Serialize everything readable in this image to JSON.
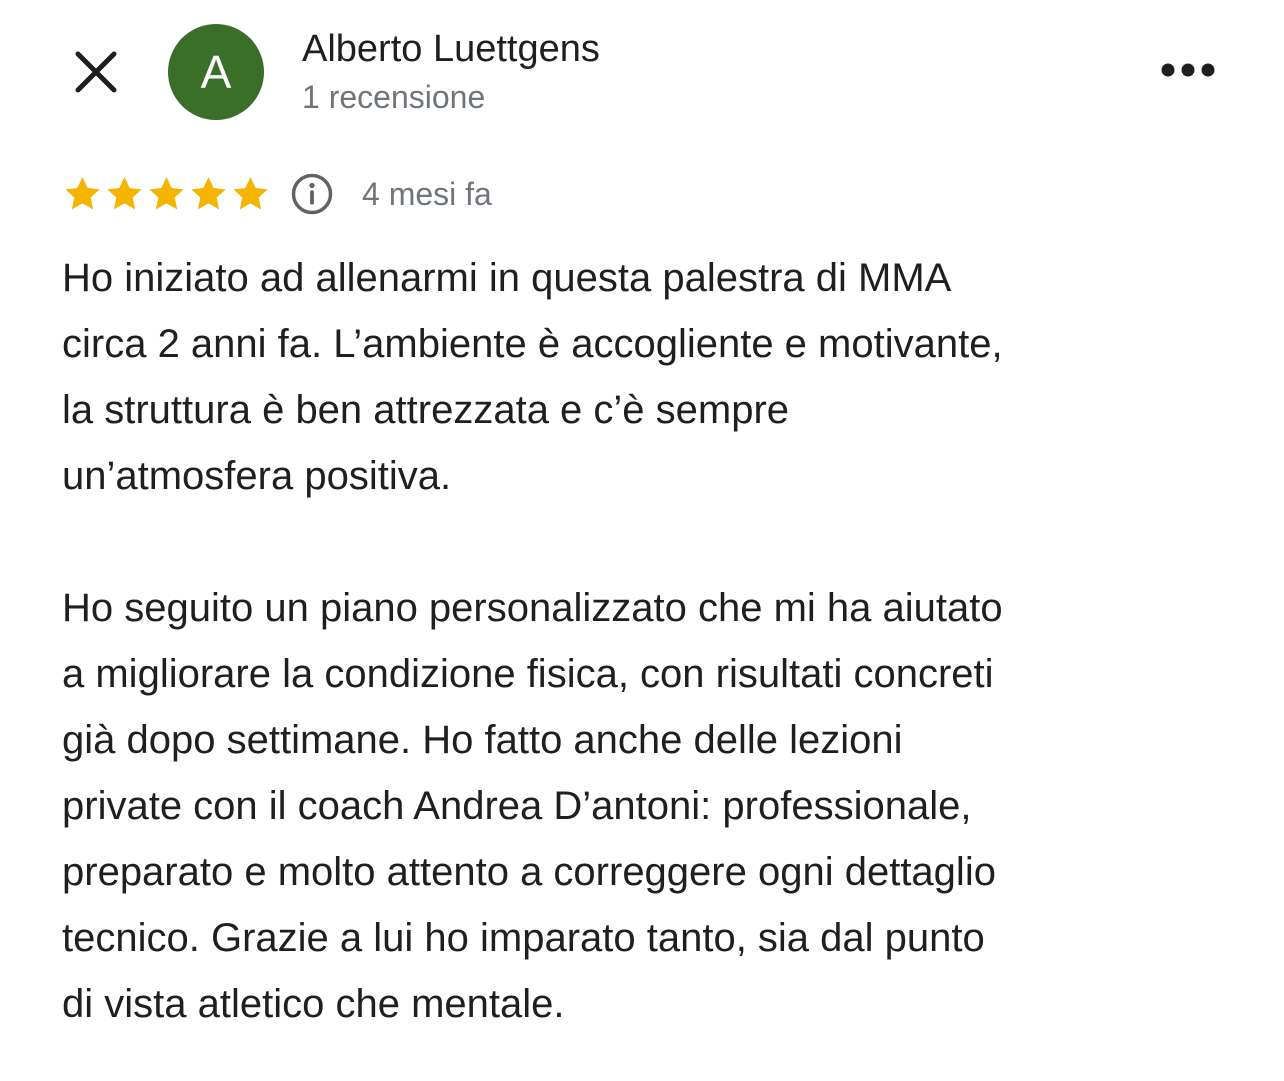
{
  "header": {
    "close_icon": "close-icon",
    "more_icon": "more-horizontal-icon",
    "avatar_letter": "A",
    "avatar_color": "#3a6f2a",
    "author_name": "Alberto Luettgens",
    "review_count": "1 recensione"
  },
  "review": {
    "rating": 5,
    "rating_max": 5,
    "star_color": "#f4b400",
    "info_icon": "info-icon",
    "date": "4 mesi fa",
    "paragraphs": [
      [
        "Ho iniziato ad allenarmi in questa palestra di MMA",
        "circa 2 anni fa. L’ambiente è accogliente e motivante,",
        "la struttura è ben attrezzata e c’è sempre",
        "un’atmosfera positiva."
      ],
      [
        "Ho seguito un piano personalizzato che mi ha aiutato",
        "a migliorare la condizione fisica, con risultati concreti",
        "già dopo settimane. Ho fatto anche delle lezioni",
        "private con il coach Andrea D’antoni: professionale,",
        "preparato e molto attento a correggere ogni dettaglio",
        "tecnico. Grazie a lui ho imparato tanto, sia dal punto",
        "di vista atletico che mentale."
      ]
    ]
  }
}
